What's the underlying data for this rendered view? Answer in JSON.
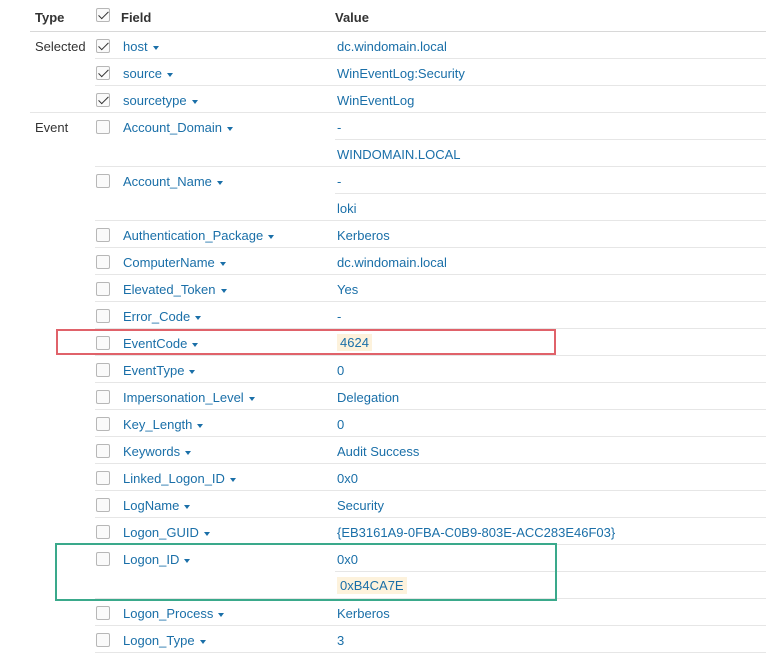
{
  "header": {
    "type": "Type",
    "field": "Field",
    "value": "Value"
  },
  "groups": {
    "selected": "Selected",
    "event": "Event"
  },
  "rows": [
    {
      "field": "host",
      "value": "dc.windomain.local",
      "checked": true
    },
    {
      "field": "source",
      "value": "WinEventLog:Security",
      "checked": true
    },
    {
      "field": "sourcetype",
      "value": "WinEventLog",
      "checked": true
    },
    {
      "field": "Account_Domain",
      "value": "-",
      "checked": false
    },
    {
      "field": "",
      "value": "WINDOMAIN.LOCAL",
      "checked": false
    },
    {
      "field": "Account_Name",
      "value": "-",
      "checked": false
    },
    {
      "field": "",
      "value": "loki",
      "checked": false
    },
    {
      "field": "Authentication_Package",
      "value": "Kerberos",
      "checked": false
    },
    {
      "field": "ComputerName",
      "value": "dc.windomain.local",
      "checked": false
    },
    {
      "field": "Elevated_Token",
      "value": "Yes",
      "checked": false
    },
    {
      "field": "Error_Code",
      "value": "-",
      "checked": false
    },
    {
      "field": "EventCode",
      "value": "4624",
      "checked": false,
      "highlight": true
    },
    {
      "field": "EventType",
      "value": "0",
      "checked": false
    },
    {
      "field": "Impersonation_Level",
      "value": "Delegation",
      "checked": false
    },
    {
      "field": "Key_Length",
      "value": "0",
      "checked": false
    },
    {
      "field": "Keywords",
      "value": "Audit Success",
      "checked": false
    },
    {
      "field": "Linked_Logon_ID",
      "value": "0x0",
      "checked": false
    },
    {
      "field": "LogName",
      "value": "Security",
      "checked": false
    },
    {
      "field": "Logon_GUID",
      "value": "{EB3161A9-0FBA-C0B9-803E-ACC283E46F03}",
      "checked": false
    },
    {
      "field": "Logon_ID",
      "value": "0x0",
      "checked": false
    },
    {
      "field": "",
      "value": "0xB4CA7E",
      "checked": false,
      "highlight": true
    },
    {
      "field": "Logon_Process",
      "value": "Kerberos",
      "checked": false
    },
    {
      "field": "Logon_Type",
      "value": "3",
      "checked": false
    }
  ],
  "colors": {
    "link": "#1a6fa8",
    "highlight_bg": "#fdf2dc",
    "red_box": "#e0626a",
    "green_box": "#3aa98b"
  },
  "icons": {
    "field_menu": "caret-down-icon",
    "select_all": "checkbox-icon"
  }
}
